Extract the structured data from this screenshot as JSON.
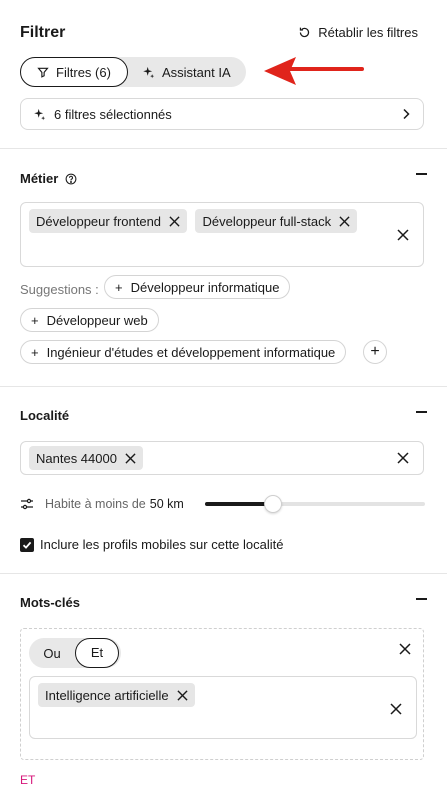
{
  "header": {
    "title": "Filtrer",
    "reset_label": "Rétablir les filtres"
  },
  "mode_switch": {
    "filters_label": "Filtres (6)",
    "ai_label": "Assistant IA",
    "active": "filters"
  },
  "selected_summary": {
    "label": "6 filtres sélectionnés"
  },
  "sections": {
    "metier": {
      "title": "Métier",
      "tags": [
        "Développeur frontend",
        "Développeur full-stack"
      ],
      "suggestions_label": "Suggestions :",
      "suggestions": [
        "Développeur informatique",
        "Développeur web",
        "Ingénieur d'études et développement informatique"
      ]
    },
    "localite": {
      "title": "Localité",
      "tags": [
        "Nantes 44000"
      ],
      "radius_label": "Habite à moins de",
      "radius_value": "50 km",
      "radius_fraction": 0.31,
      "mobile_label": "Inclure les profils mobiles sur cette localité",
      "mobile_checked": true
    },
    "mots_cles": {
      "title": "Mots-clés",
      "operator_or": "Ou",
      "operator_and": "Et",
      "active_operator": "Et",
      "tags": [
        "Intelligence artificielle"
      ],
      "join_label": "ET"
    }
  },
  "colors": {
    "accent_arrow": "#e0241b",
    "join_link": "#d6167a"
  }
}
